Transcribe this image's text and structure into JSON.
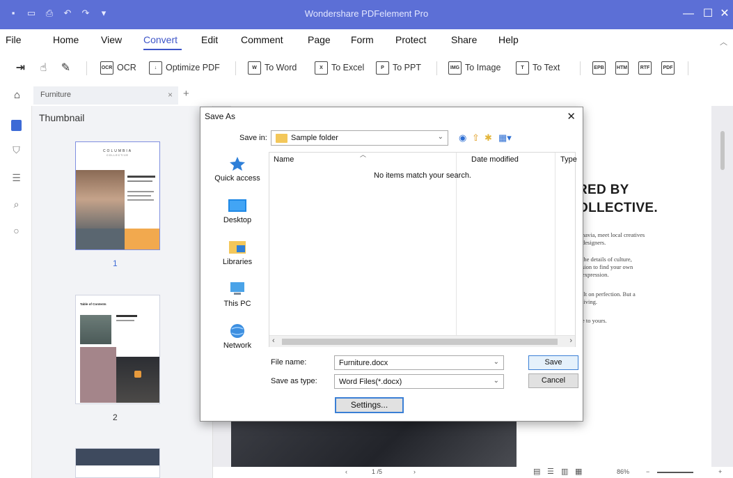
{
  "app": {
    "title": "Wondershare PDFelement Pro",
    "accent": "#5c6fd6"
  },
  "quick_access": [
    "app-logo-icon",
    "save-icon",
    "print-icon",
    "undo-icon",
    "redo-icon",
    "customize-icon"
  ],
  "window_controls": {
    "minimize": "—",
    "maximize": "☐",
    "close": "✕"
  },
  "menu": {
    "items": [
      "File",
      "Home",
      "View",
      "Convert",
      "Edit",
      "Comment",
      "Page",
      "Form",
      "Protect",
      "Share",
      "Help"
    ],
    "active": "Convert"
  },
  "toolbar": {
    "ocr": "OCR",
    "optimize": "Optimize PDF",
    "to_word": "To Word",
    "to_excel": "To Excel",
    "to_ppt": "To PPT",
    "to_image": "To Image",
    "to_text": "To Text"
  },
  "tab": {
    "label": "Furniture",
    "close": "×",
    "add": "+"
  },
  "thumbnail_panel": {
    "header": "Thumbnail",
    "pages": [
      {
        "number": "1",
        "brand": "COLUMBIA",
        "sub": "COLLECTIVE"
      },
      {
        "number": "2",
        "heading": "Table of Contents"
      }
    ]
  },
  "document": {
    "heading_line1": "RED BY",
    "heading_line2": "OLLECTIVE.",
    "paragraphs": [
      [
        "navia, meet local creatives",
        "designers."
      ],
      [
        "the details of culture,",
        "sion to find your own",
        "expression."
      ],
      [
        "ilt on perfection. But a",
        "living."
      ],
      [
        "e to yours."
      ]
    ]
  },
  "statusbar": {
    "page": "1 /5",
    "zoom": "86%",
    "zoom_minus": "−",
    "zoom_plus": "+"
  },
  "dialog": {
    "title": "Save As",
    "save_in_label": "Save in:",
    "save_in_value": "Sample folder",
    "places": [
      "Quick access",
      "Desktop",
      "Libraries",
      "This PC",
      "Network"
    ],
    "columns": {
      "name": "Name",
      "date_modified": "Date modified",
      "type": "Type"
    },
    "empty_message": "No items match your search.",
    "file_name_label": "File name:",
    "file_name_value": "Furniture.docx",
    "save_as_type_label": "Save as type:",
    "save_as_type_value": "Word Files(*.docx)",
    "save_button": "Save",
    "cancel_button": "Cancel",
    "settings_button": "Settings..."
  }
}
